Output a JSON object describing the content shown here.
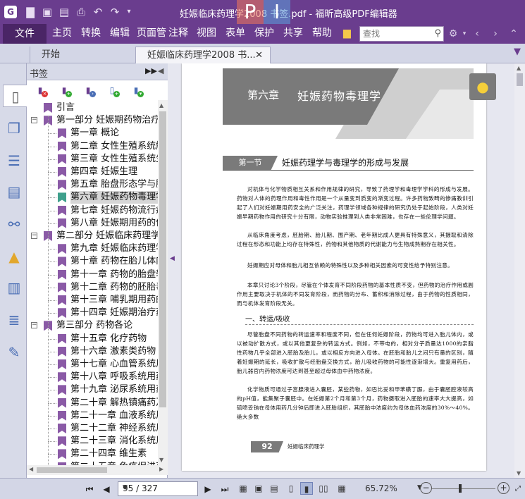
{
  "window": {
    "title": "妊娠临床药理学2008 书签.pdf - 福昕高级PDF编辑器",
    "watermark_left": "P",
    "watermark_right": "I",
    "app_icon": "G",
    "accent": "#6a3d8e"
  },
  "quick_access": [
    "folder-icon",
    "save-icon",
    "save-as-icon",
    "print-icon",
    "undo-icon",
    "redo-icon",
    "dropdown-icon"
  ],
  "menu": {
    "file": "文件",
    "items": [
      "主页",
      "转换",
      "编辑",
      "页面管",
      "注释",
      "视图",
      "表单",
      "保护",
      "共享",
      "帮助"
    ],
    "search_placeholder": "查找"
  },
  "tabs": {
    "home": "开始",
    "document": "妊娠临床药理学2008 书..."
  },
  "bookmarks": {
    "title": "书签",
    "items": [
      {
        "label": "引言",
        "level": 0,
        "exp": ""
      },
      {
        "label": "第一部分 妊娠期药物治疗基",
        "level": 0,
        "exp": "−"
      },
      {
        "label": "第一章 概论",
        "level": 1,
        "exp": ""
      },
      {
        "label": "第二章 女性生殖系统解",
        "level": 1,
        "exp": ""
      },
      {
        "label": "第三章 女性生殖系统生",
        "level": 1,
        "exp": ""
      },
      {
        "label": "第四章 妊娠生理",
        "level": 1,
        "exp": ""
      },
      {
        "label": "第五章 胎盘形态学与胎",
        "level": 1,
        "exp": ""
      },
      {
        "label": "第六章 妊娠药物毒理学",
        "level": 1,
        "exp": "",
        "selected": true
      },
      {
        "label": "第七章 妊娠药物流行病",
        "level": 1,
        "exp": ""
      },
      {
        "label": "第八章 妊娠期用药的伦",
        "level": 1,
        "exp": ""
      },
      {
        "label": "第二部分 妊娠临床药理学",
        "level": 0,
        "exp": "−"
      },
      {
        "label": "第九章 妊娠临床药理学",
        "level": 1,
        "exp": ""
      },
      {
        "label": "第十章 药物在胎儿体内",
        "level": 1,
        "exp": ""
      },
      {
        "label": "第十一章 药物的胎盘转",
        "level": 1,
        "exp": ""
      },
      {
        "label": "第十二章 药物的胚胎毒",
        "level": 1,
        "exp": ""
      },
      {
        "label": "第十三章 哺乳期用药的",
        "level": 1,
        "exp": ""
      },
      {
        "label": "第十四章 妊娠期治疗药",
        "level": 1,
        "exp": ""
      },
      {
        "label": "第三部分 药物各论",
        "level": 0,
        "exp": "−"
      },
      {
        "label": "第十五章 化疗药物",
        "level": 1,
        "exp": ""
      },
      {
        "label": "第十六章 激素类药物",
        "level": 1,
        "exp": ""
      },
      {
        "label": "第十七章 心血管系统用",
        "level": 1,
        "exp": ""
      },
      {
        "label": "第十八章 呼吸系统用药",
        "level": 1,
        "exp": ""
      },
      {
        "label": "第十九章 泌尿系统用药",
        "level": 1,
        "exp": ""
      },
      {
        "label": "第二十章 解热镇痛药及",
        "level": 1,
        "exp": ""
      },
      {
        "label": "第二十一章 血液系统用",
        "level": 1,
        "exp": ""
      },
      {
        "label": "第二十二章 神经系统用",
        "level": 1,
        "exp": ""
      },
      {
        "label": "第二十三章 消化系统用",
        "level": 1,
        "exp": ""
      },
      {
        "label": "第二十四章 维生素",
        "level": 1,
        "exp": ""
      },
      {
        "label": "第二十五章 免疫促进药",
        "level": 1,
        "exp": ""
      }
    ]
  },
  "page": {
    "chapter_num": "第六章",
    "chapter_title": "妊娠药物毒理学",
    "section_tag": "第一节",
    "section_title": "妊娠药理学与毒理学的形成与发展",
    "paragraphs": [
      "对机体与化学物质相互关系和作用规律的研究，导致了药理学和毒理学学科的形成与发展。药物对人体的药理作用和毒性作用是一个从量变到质变的渐变过程。许多药物致畸的惨痛教训引起了人们对妊娠期用药安全的广泛关注，药理学领域各种规律的研究仍处于起始阶段，人类对妊娠早期药物作用的研究十分有限，动物实验推理到人类非常困难，也存在一些伦理学问题。",
      "从临床角度考虑，胚胎期、胎儿期、围产期、老年期比成人更具有特殊意义，其摄取和清除过程在形态和功能上均存在特殊性，药物和其他物质的代谢能力与生物成熟期存在相关性。",
      "妊娠期应对母体和胎儿相互依赖的特殊性以及多种相关因素的可变性给予特别注意。",
      "本章只讨论3个阶段，尽管在个体发育不同阶段药物的基本性质不变，但药物的治疗作用或副作用主要取决于机体的不同发育阶段，而药物的分布、蓄积和消除过程，由于药物的性质相同，而与机体发育阶段无关。"
    ],
    "subhead": "一、转运/吸收",
    "paragraphs2": [
      "尽管胎盘不同药物的转运速率和程度不同，但在任何妊娠阶段，药物均可进入胎儿体内，或以被动扩散方式，或以其他更复杂的转运方式。例如，不带电的，相对分子质量达1000的亲脂性药物几乎全部进入胚胎及胎儿，或以相反方向进入母体。在胚胎和胎儿之间只有量的区别，随着妊娠期的延长，吸收扩散与经胎盘交换方式，胎儿吸收药物的可能性逐渐增大。重复用药后，胎儿器官内药物浓度可达到甚至超过母体血中药物浓度。",
      "化学物质可通过子宫腺液进入囊胚，某些药物，如巴比妥和甲苯磺丁脲，由于囊胚腔液较高的pH值，能集聚于囊胚中。在妊娠第2个月和第3个月，药物摄取进入胚胎的速率大大提高，如硫喷妥钠在母体用药几分钟后即进入胚胎组织，其胚胎中浓度约为母体血药浓度的30%～40%。绝大多数"
    ],
    "footer_num": "92",
    "footer_book": "妊娠临床药理学"
  },
  "status": {
    "page_display": "95 / 327",
    "zoom": "65.72%"
  }
}
